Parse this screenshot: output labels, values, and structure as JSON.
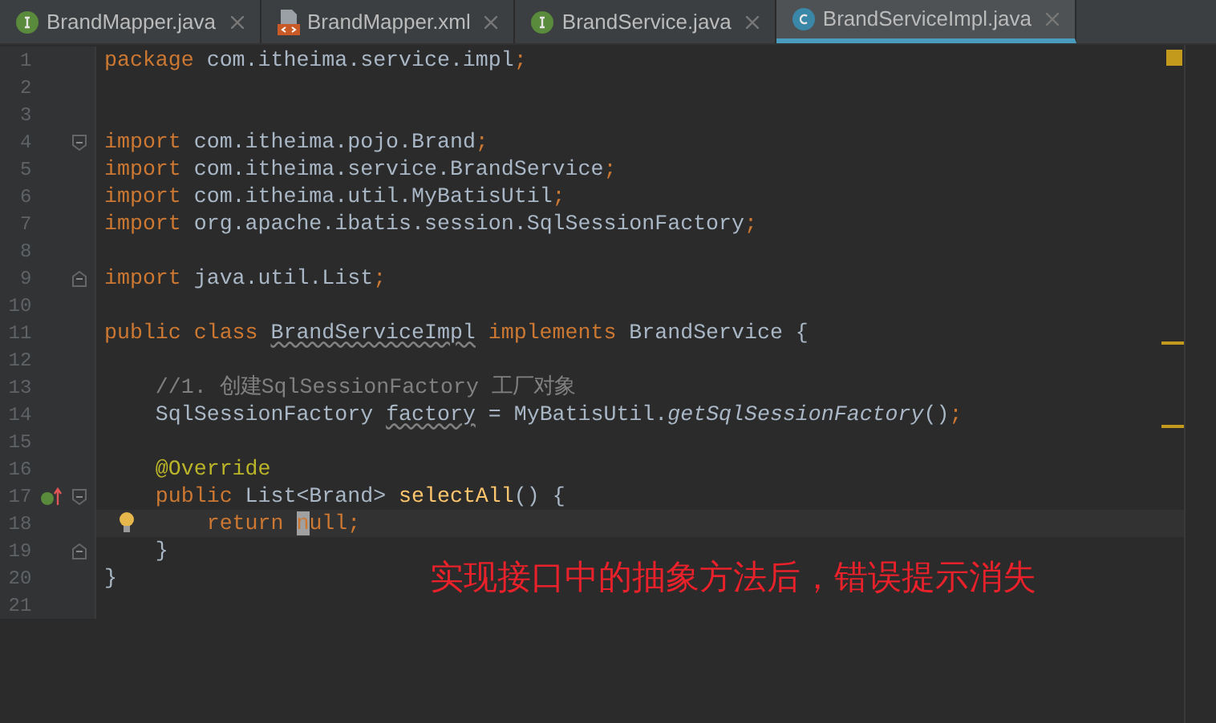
{
  "tabs": [
    {
      "label": "BrandMapper.java",
      "kind": "interface",
      "selected": false
    },
    {
      "label": "BrandMapper.xml",
      "kind": "xml",
      "selected": false
    },
    {
      "label": "BrandService.java",
      "kind": "interface",
      "selected": false
    },
    {
      "label": "BrandServiceImpl.java",
      "kind": "class",
      "selected": true
    }
  ],
  "editor": {
    "lines": [
      {
        "number": "1",
        "tokens": [
          {
            "kind": "kw",
            "text": "package"
          },
          {
            "kind": "text",
            "text": " com.itheima.service.impl"
          },
          {
            "kind": "kw",
            "text": ";"
          }
        ]
      },
      {
        "number": "2"
      },
      {
        "number": "3"
      },
      {
        "number": "4",
        "fold_start": true,
        "tokens": [
          {
            "kind": "kw",
            "text": "import"
          },
          {
            "kind": "text",
            "text": " com.itheima.pojo.Brand"
          },
          {
            "kind": "kw",
            "text": ";"
          }
        ]
      },
      {
        "number": "5",
        "tokens": [
          {
            "kind": "kw",
            "text": "import"
          },
          {
            "kind": "text",
            "text": " com.itheima.service.BrandService"
          },
          {
            "kind": "kw",
            "text": ";"
          }
        ]
      },
      {
        "number": "6",
        "tokens": [
          {
            "kind": "kw",
            "text": "import"
          },
          {
            "kind": "text",
            "text": " com.itheima.util.MyBatisUtil"
          },
          {
            "kind": "kw",
            "text": ";"
          }
        ]
      },
      {
        "number": "7",
        "tokens": [
          {
            "kind": "kw",
            "text": "import"
          },
          {
            "kind": "text",
            "text": " org.apache.ibatis.session.SqlSessionFactory"
          },
          {
            "kind": "kw",
            "text": ";"
          }
        ]
      },
      {
        "number": "8"
      },
      {
        "number": "9",
        "fold_end": true,
        "tokens": [
          {
            "kind": "kw",
            "text": "import"
          },
          {
            "kind": "text",
            "text": " java.util.List"
          },
          {
            "kind": "kw",
            "text": ";"
          }
        ]
      },
      {
        "number": "10"
      },
      {
        "number": "11",
        "tokens": [
          {
            "kind": "kw",
            "text": "public class "
          },
          {
            "kind": "warn",
            "text": "BrandServiceImpl"
          },
          {
            "kind": "kw",
            "text": " implements"
          },
          {
            "kind": "text",
            "text": " BrandService {"
          }
        ]
      },
      {
        "number": "12"
      },
      {
        "number": "13",
        "tokens": [
          {
            "kind": "comment",
            "text": "    //1. 创建SqlSessionFactory 工厂对象"
          }
        ]
      },
      {
        "number": "14",
        "tokens": [
          {
            "kind": "text",
            "text": "    SqlSessionFactory "
          },
          {
            "kind": "warn",
            "text": "factory"
          },
          {
            "kind": "text",
            "text": " = MyBatisUtil."
          },
          {
            "kind": "static",
            "text": "getSqlSessionFactory"
          },
          {
            "kind": "text",
            "text": "()"
          },
          {
            "kind": "kw",
            "text": ";"
          }
        ]
      },
      {
        "number": "15"
      },
      {
        "number": "16",
        "tokens": [
          {
            "kind": "annotation",
            "text": "    @Override"
          }
        ]
      },
      {
        "number": "17",
        "fold_start": true,
        "implements_marker": true,
        "tokens": [
          {
            "kind": "kw",
            "text": "    public "
          },
          {
            "kind": "text",
            "text": "List<Brand> "
          },
          {
            "kind": "method",
            "text": "selectAll"
          },
          {
            "kind": "text",
            "text": "() {"
          }
        ]
      },
      {
        "number": "18",
        "current": true,
        "bulb": true,
        "tokens": [
          {
            "kind": "kw",
            "text": "        return "
          },
          {
            "kind": "caret",
            "text": "n"
          },
          {
            "kind": "kw",
            "text": "ull;"
          }
        ]
      },
      {
        "number": "19",
        "fold_end": true,
        "tokens": [
          {
            "kind": "text",
            "text": "    }"
          }
        ]
      },
      {
        "number": "20",
        "tokens": [
          {
            "kind": "text",
            "text": "}"
          }
        ]
      },
      {
        "number": "21"
      }
    ]
  },
  "annotation": "实现接口中的抽象方法后，错误提示消失"
}
